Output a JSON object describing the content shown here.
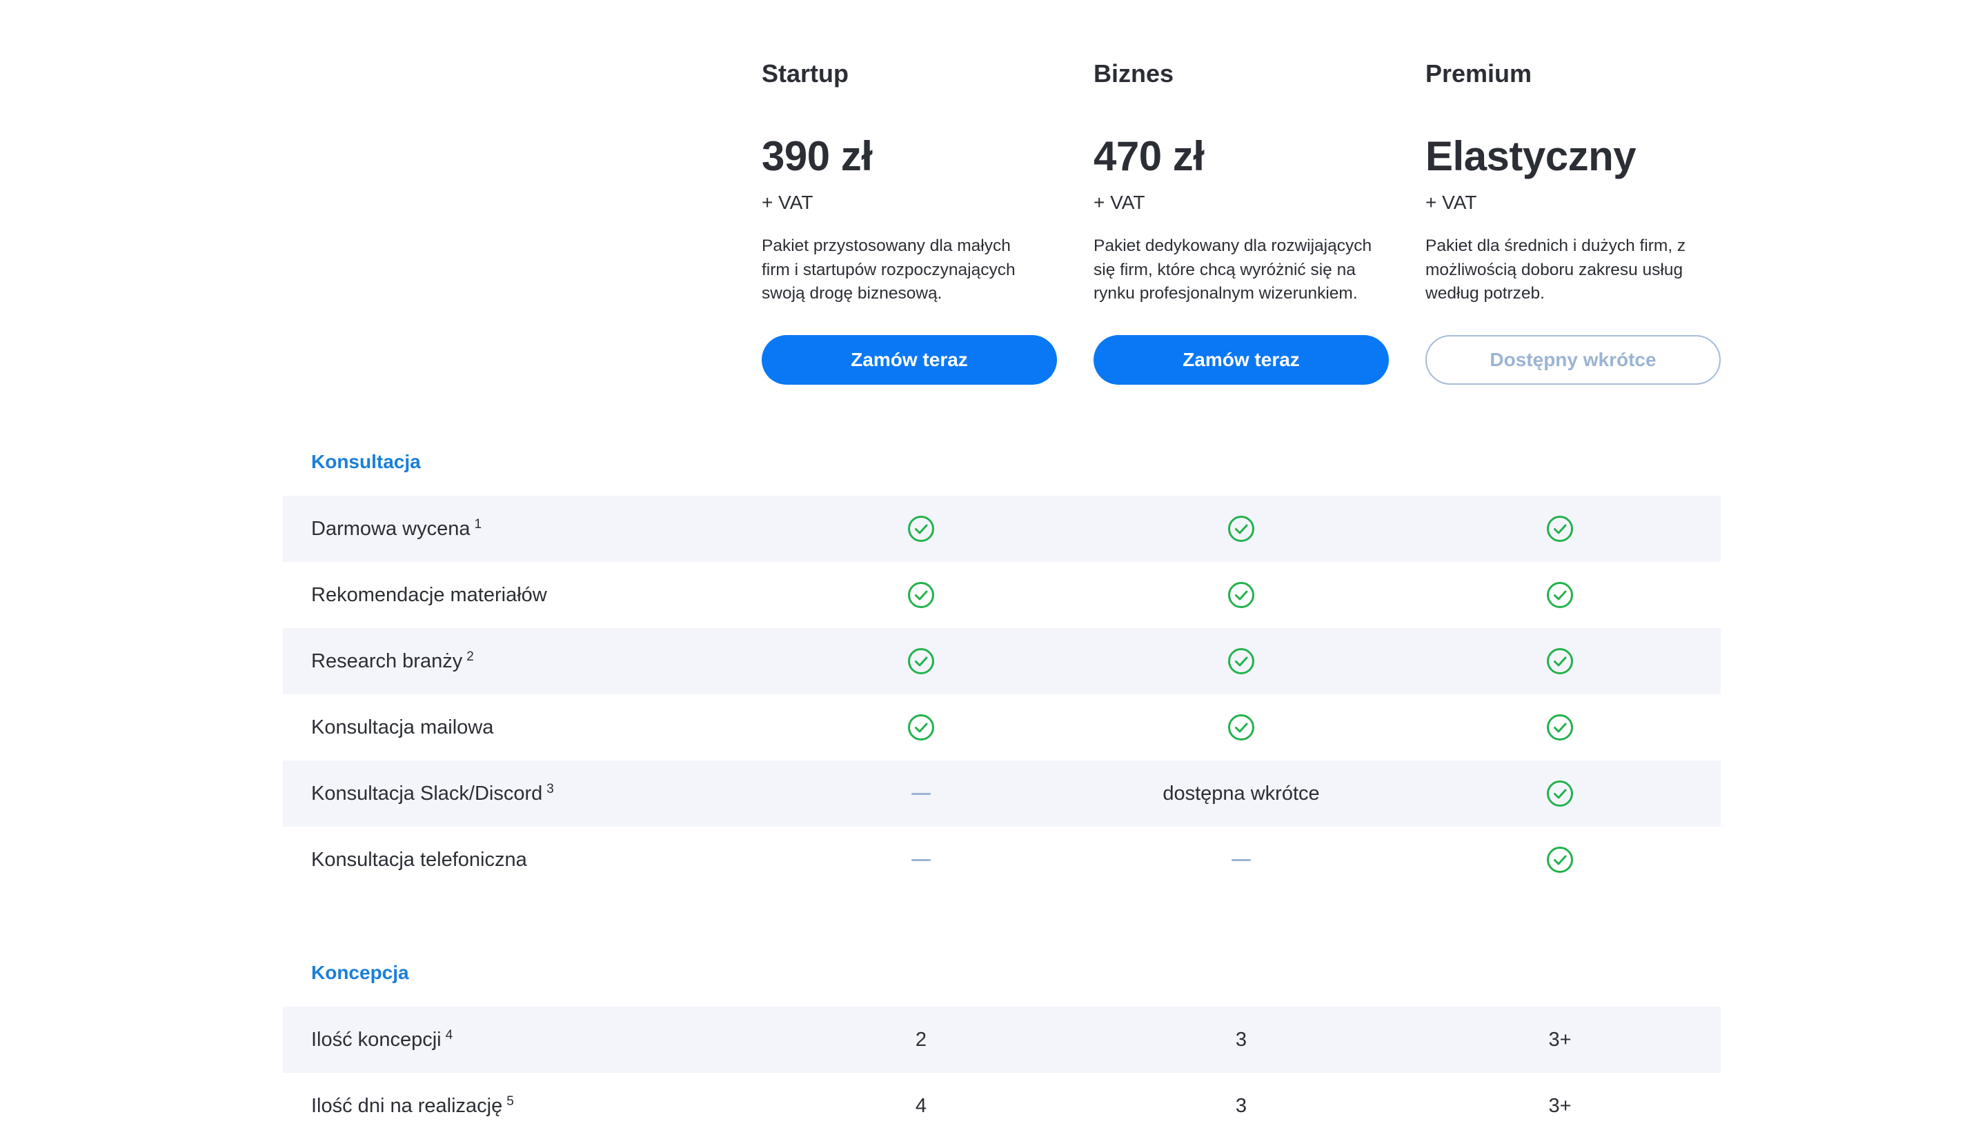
{
  "plans": [
    {
      "name": "Startup",
      "price": "390 zł",
      "vat": "+ VAT",
      "desc_lines": [
        "Pakiet przystosowany dla małych",
        "firm i startupów rozpoczynających",
        "swoją drogę biznesową."
      ],
      "button": "Zamów teraz",
      "button_state": "active"
    },
    {
      "name": "Biznes",
      "price": "470 zł",
      "vat": "+ VAT",
      "desc_lines": [
        "Pakiet dedykowany dla rozwijających",
        "się firm, które chcą wyróżnić się na",
        "rynku profesjonalnym wizerunkiem."
      ],
      "button": "Zamów teraz",
      "button_state": "active"
    },
    {
      "name": "Premium",
      "price": "Elastyczny",
      "vat": "+ VAT",
      "desc_lines": [
        "Pakiet dla średnich i dużych firm, z",
        "możliwością doboru zakresu usług",
        "według potrzeb."
      ],
      "button": "Dostępny wkrótce",
      "button_state": "disabled"
    }
  ],
  "sections": [
    {
      "title": "Konsultacja",
      "rows": [
        {
          "label": "Darmowa wycena",
          "note": "1",
          "cells": [
            {
              "icon": "check-icon"
            },
            {
              "icon": "check-icon"
            },
            {
              "icon": "check-icon"
            }
          ]
        },
        {
          "label": "Rekomendacje materiałów",
          "note": "",
          "cells": [
            {
              "icon": "check-icon"
            },
            {
              "icon": "check-icon"
            },
            {
              "icon": "check-icon"
            }
          ]
        },
        {
          "label": "Research branży",
          "note": "2",
          "cells": [
            {
              "icon": "check-icon"
            },
            {
              "icon": "check-icon"
            },
            {
              "icon": "check-icon"
            }
          ]
        },
        {
          "label": "Konsultacja mailowa",
          "note": "",
          "cells": [
            {
              "icon": "check-icon"
            },
            {
              "icon": "check-icon"
            },
            {
              "icon": "check-icon"
            }
          ]
        },
        {
          "label": "Konsultacja Slack/Discord",
          "note": "3",
          "cells": [
            {
              "icon": "dash-icon"
            },
            {
              "text": "dostępna wkrótce"
            },
            {
              "icon": "check-icon"
            }
          ]
        },
        {
          "label": "Konsultacja telefoniczna",
          "note": "",
          "cells": [
            {
              "icon": "dash-icon"
            },
            {
              "icon": "dash-icon"
            },
            {
              "icon": "check-icon"
            }
          ]
        }
      ]
    },
    {
      "title": "Koncepcja",
      "rows": [
        {
          "label": "Ilość koncepcji",
          "note": "4",
          "cells": [
            {
              "text": "2"
            },
            {
              "text": "3"
            },
            {
              "text": "3+"
            }
          ]
        },
        {
          "label": "Ilość dni na realizację",
          "note": "5",
          "cells": [
            {
              "text": "4"
            },
            {
              "text": "3"
            },
            {
              "text": "3+"
            }
          ]
        }
      ]
    }
  ],
  "colors": {
    "accent": "#0a78f5",
    "section_title": "#1a7fd8",
    "check": "#22b24c",
    "dash": "#9bb4d3",
    "row_shade": "#f3f5fb",
    "text": "#2b2e34"
  }
}
